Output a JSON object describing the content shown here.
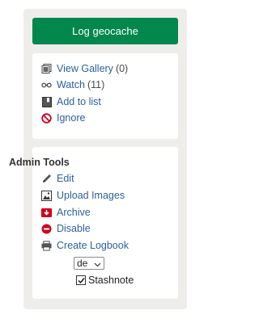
{
  "log_button": "Log geocache",
  "actions": [
    {
      "label": "View Gallery",
      "count": "(0)",
      "icon": "gallery-icon"
    },
    {
      "label": "Watch",
      "count": "(11)",
      "icon": "glasses-icon"
    },
    {
      "label": "Add to list",
      "count": "",
      "icon": "bookmark-icon"
    },
    {
      "label": "Ignore",
      "count": "",
      "icon": "no-entry-icon"
    }
  ],
  "admin": {
    "heading": "Admin Tools",
    "items": [
      {
        "label": "Edit",
        "icon": "pencil-icon"
      },
      {
        "label": "Upload Images",
        "icon": "image-icon"
      },
      {
        "label": "Archive",
        "icon": "archive-icon"
      },
      {
        "label": "Disable",
        "icon": "disable-icon"
      },
      {
        "label": "Create Logbook",
        "icon": "printer-icon"
      }
    ],
    "language_select": "de",
    "stashnote_label": "Stashnote",
    "stashnote_checked": true
  },
  "colors": {
    "primary_green": "#02874d",
    "link_blue": "#2e5f9c",
    "panel_bg": "#efedea",
    "danger_red": "#d0021b"
  }
}
